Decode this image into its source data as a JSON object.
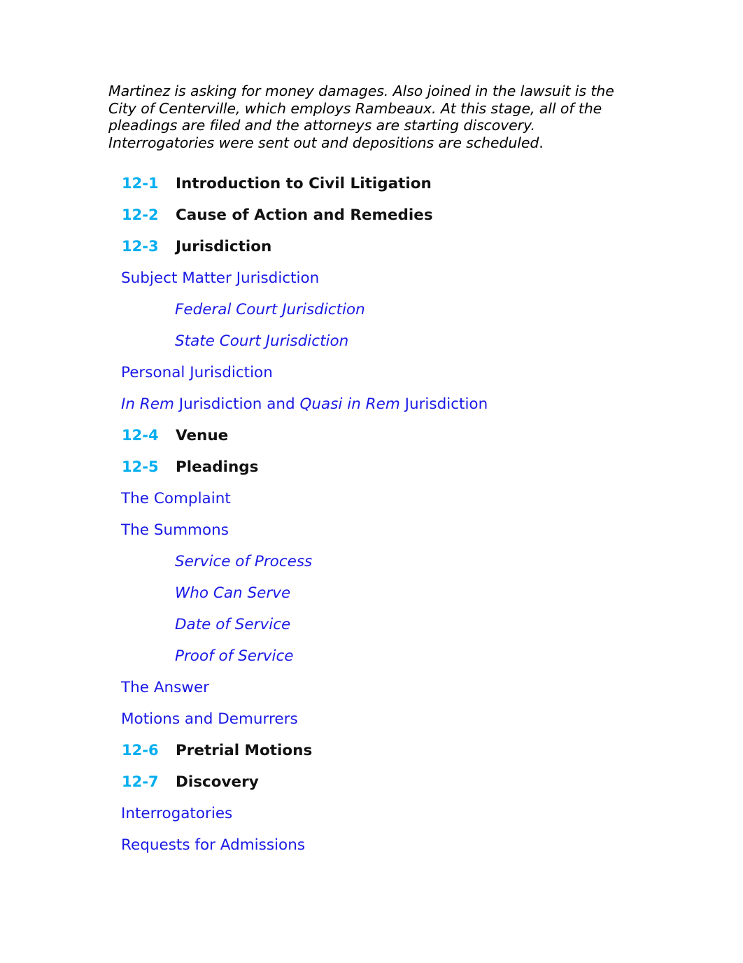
{
  "document": {
    "intro_paragraph": {
      "italic_text": "Martinez is asking for money damages. Also joined in the lawsuit is the City of Centerville, which employs Rambeaux. At this stage, all of the pleadings are filed and the attorneys are starting discovery. Interrogatories were sent out and depositions are scheduled",
      "trailing_period": "."
    },
    "outline": [
      {
        "level": 1,
        "number": "12-1",
        "text": "Introduction to Civil Litigation"
      },
      {
        "level": 1,
        "number": "12-2",
        "text": "Cause of Action and Remedies"
      },
      {
        "level": 1,
        "number": "12-3",
        "text": "Jurisdiction"
      },
      {
        "level": 2,
        "number": "",
        "text": "Subject Matter Jurisdiction"
      },
      {
        "level": 3,
        "number": "",
        "text": "Federal Court Jurisdiction"
      },
      {
        "level": 3,
        "number": "",
        "text": "State Court Jurisdiction"
      },
      {
        "level": 2,
        "number": "",
        "text": "Personal Jurisdiction"
      },
      {
        "level": 2,
        "number": "",
        "text": "In Rem Jurisdiction and Quasi in Rem Jurisdiction",
        "runs": [
          {
            "text": "In Rem",
            "italic": true
          },
          {
            "text": " Jurisdiction and ",
            "italic": false
          },
          {
            "text": "Quasi in Rem",
            "italic": true
          },
          {
            "text": " Jurisdiction",
            "italic": false
          }
        ]
      },
      {
        "level": 1,
        "number": "12-4",
        "text": "Venue"
      },
      {
        "level": 1,
        "number": "12-5",
        "text": "Pleadings"
      },
      {
        "level": 2,
        "number": "",
        "text": "The Complaint"
      },
      {
        "level": 2,
        "number": "",
        "text": "The Summons"
      },
      {
        "level": 3,
        "number": "",
        "text": "Service of Process"
      },
      {
        "level": 3,
        "number": "",
        "text": "Who Can Serve"
      },
      {
        "level": 3,
        "number": "",
        "text": "Date of Service"
      },
      {
        "level": 3,
        "number": "",
        "text": "Proof of Service"
      },
      {
        "level": 2,
        "number": "",
        "text": "The Answer"
      },
      {
        "level": 2,
        "number": "",
        "text": "Motions and Demurrers"
      },
      {
        "level": 1,
        "number": "12-6",
        "text": "Pretrial Motions"
      },
      {
        "level": 1,
        "number": "12-7",
        "text": "Discovery"
      },
      {
        "level": 2,
        "number": "",
        "text": "Interrogatories"
      },
      {
        "level": 2,
        "number": "",
        "text": "Requests for Admissions"
      }
    ]
  },
  "colors": {
    "section_number": "#00AEEF",
    "subsection_link": "#1A1AE6",
    "section_title": "#111111",
    "body_text": "#000000",
    "page_background": "#ffffff"
  }
}
